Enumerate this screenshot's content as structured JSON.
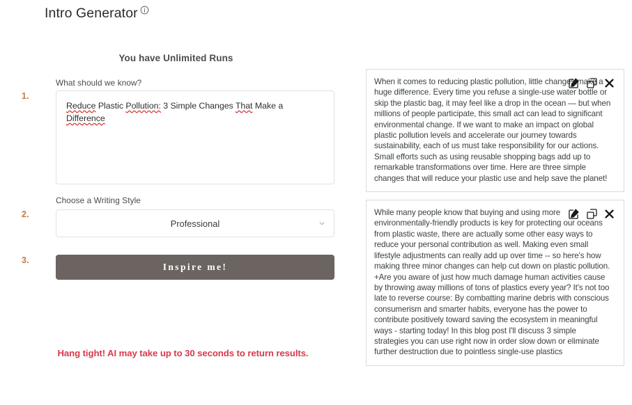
{
  "header": {
    "title": "Intro Generator",
    "info_icon": "info-circle-icon"
  },
  "form": {
    "runs_banner": "You have Unlimited Runs",
    "steps": [
      "1.",
      "2.",
      "3."
    ],
    "prompt": {
      "label": "What should we know?",
      "value": "Reduce Plastic Pollution: 3 Simple Changes That Make a Difference",
      "misspelled_words": [
        "Reduce",
        "Pollution:",
        "That",
        "Difference"
      ]
    },
    "style": {
      "label": "Choose a Writing Style",
      "selected": "Professional",
      "chevron_icon": "chevron-down-icon"
    },
    "submit_label": "Inspire me!",
    "notice": "Hang tight! AI may take up to 30 seconds\nto return results."
  },
  "results": {
    "card_actions": [
      "edit-icon",
      "copy-icon",
      "close-icon"
    ],
    "items": [
      {
        "text": "When it comes to reducing plastic pollution, little changes make a huge difference. Every time you refuse a single-use water bottle or skip the plastic bag, it may feel like a drop in the ocean — but when millions of people participate, this small act can lead to significant environmental change. If we want to make an impact on global plastic pollution levels and accelerate our journey towards sustainability, each of us must take responsibility for our actions. Small efforts such as using reusable shopping bags add up to remarkable transformations over time. Here are three simple changes that will reduce your plastic use and help save the planet!"
      },
      {
        "text": "While many people know that buying and using more environmentally-friendly products is key for protecting our oceans from plastic waste, there are actually some other easy ways to reduce your personal contribution as well. Making even small lifestyle adjustments can really add up over time -- so here's how making three minor changes can help cut down on plastic pollution. +Are you aware of just how much damage human activities cause by throwing away millions of tons of plastics every year? It's not too late to reverse course: By combatting marine debris with conscious consumerism and smarter habits, everyone has the power to contribute positively toward saving the ecosystem in meaningful ways - starting today! In this blog post I'll discuss 3 simple strategies you can use right now in order slow down or eliminate further destruction due to pointless single-use plastics"
      }
    ]
  },
  "colors": {
    "step_number": "#c87941",
    "button_bg": "#6b6460",
    "notice": "#d83a4a",
    "spellcheck": "#d93838"
  }
}
